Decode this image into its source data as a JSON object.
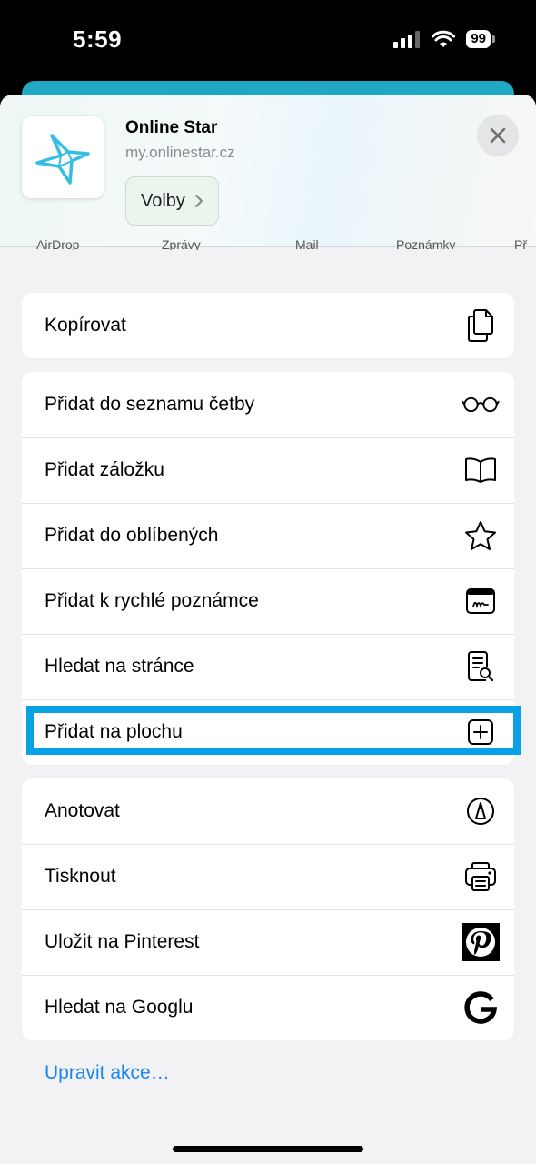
{
  "status_bar": {
    "time": "5:59",
    "battery": "99"
  },
  "share_header": {
    "title": "Online Star",
    "url": "my.onlinestar.cz",
    "options_label": "Volby",
    "peek_labels": [
      "AirDrop",
      "Zprávy",
      "Mail",
      "Poznámky",
      "Př"
    ]
  },
  "groups": [
    {
      "items": [
        {
          "label": "Kopírovat",
          "icon": "copy-icon"
        }
      ]
    },
    {
      "items": [
        {
          "label": "Přidat do seznamu četby",
          "icon": "glasses-icon"
        },
        {
          "label": "Přidat záložku",
          "icon": "book-icon"
        },
        {
          "label": "Přidat do oblíbených",
          "icon": "star-icon"
        },
        {
          "label": "Přidat k rychlé poznámce",
          "icon": "quick-note-icon"
        },
        {
          "label": "Hledat na stránce",
          "icon": "find-in-page-icon"
        },
        {
          "label": "Přidat na plochu",
          "icon": "add-square-icon",
          "highlighted": true
        }
      ]
    },
    {
      "items": [
        {
          "label": "Anotovat",
          "icon": "markup-icon"
        },
        {
          "label": "Tisknout",
          "icon": "printer-icon"
        },
        {
          "label": "Uložit na Pinterest",
          "icon": "pinterest-icon"
        },
        {
          "label": "Hledat na Googlu",
          "icon": "google-icon"
        }
      ]
    }
  ],
  "edit_actions_label": "Upravit akce…",
  "colors": {
    "accent_link": "#1a84f0",
    "highlight": "#0aa0e4",
    "app_icon": "#35bde6"
  }
}
